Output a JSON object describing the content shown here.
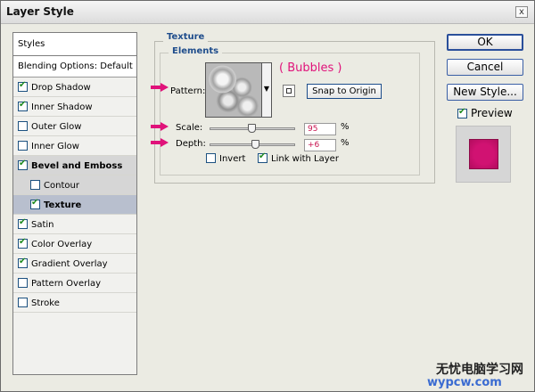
{
  "window": {
    "title": "Layer Style",
    "close_glyph": "x"
  },
  "sidebar": {
    "header": "Styles",
    "blending_options": "Blending Options: Default",
    "items": [
      {
        "label": "Drop Shadow",
        "checked": true
      },
      {
        "label": "Inner Shadow",
        "checked": true
      },
      {
        "label": "Outer Glow",
        "checked": false
      },
      {
        "label": "Inner Glow",
        "checked": false
      },
      {
        "label": "Bevel and Emboss",
        "checked": true
      },
      {
        "label": "Contour",
        "checked": false
      },
      {
        "label": "Texture",
        "checked": true
      },
      {
        "label": "Satin",
        "checked": true
      },
      {
        "label": "Color Overlay",
        "checked": true
      },
      {
        "label": "Gradient Overlay",
        "checked": true
      },
      {
        "label": "Pattern Overlay",
        "checked": false
      },
      {
        "label": "Stroke",
        "checked": false
      }
    ]
  },
  "texture": {
    "group_title": "Texture",
    "elements_title": "Elements",
    "pattern_label": "Pattern:",
    "pattern_note": "( Bubbles )",
    "snap_button": "Snap to Origin",
    "scale_label": "Scale:",
    "scale_value": "95",
    "depth_label": "Depth:",
    "depth_value": "+6",
    "percent": "%",
    "invert_label": "Invert",
    "invert_checked": false,
    "link_label": "Link with Layer",
    "link_checked": true,
    "annotation_color": "#e0127a"
  },
  "buttons": {
    "ok": "OK",
    "cancel": "Cancel",
    "new_style": "New Style..."
  },
  "preview": {
    "label": "Preview",
    "checked": true,
    "swatch_color": "#d11272"
  },
  "watermark": {
    "line1": "无忧电脑学习网",
    "line2": "wypcw.com"
  }
}
